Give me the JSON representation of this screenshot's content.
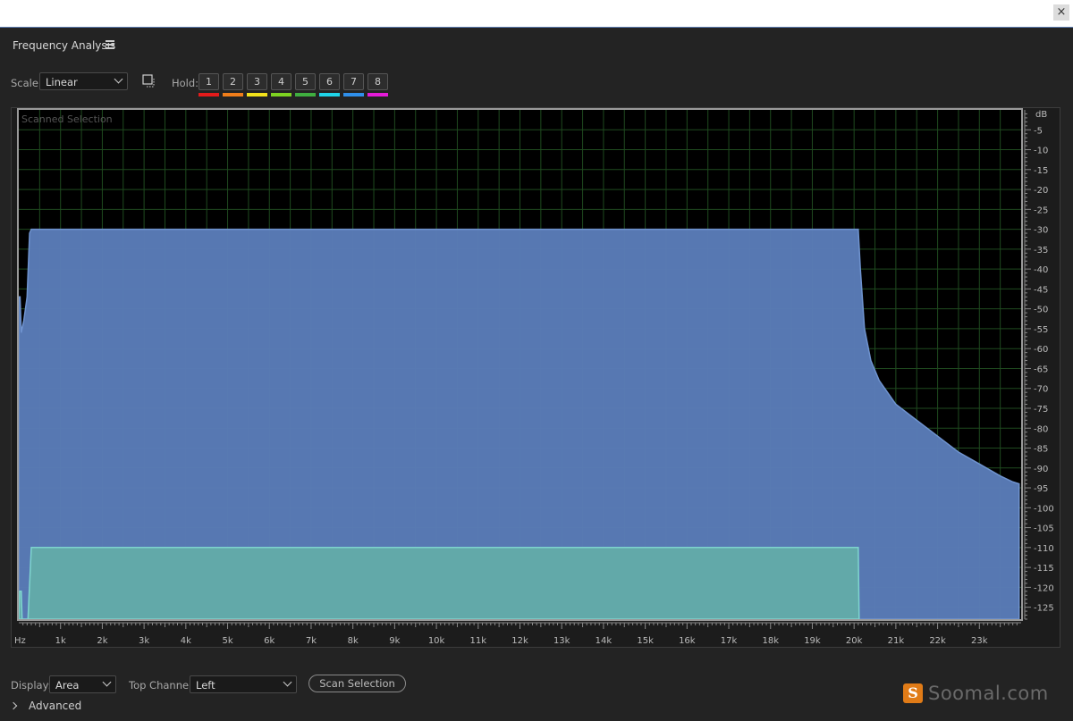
{
  "window": {
    "close_label": "×"
  },
  "panel": {
    "title": "Frequency Analysis"
  },
  "toolbar": {
    "scale_label": "Scale:",
    "scale_value": "Linear",
    "hold_label": "Hold:",
    "hold_buttons": [
      {
        "label": "1",
        "color": "#e41b1b"
      },
      {
        "label": "2",
        "color": "#f07d1a"
      },
      {
        "label": "3",
        "color": "#f2e21b"
      },
      {
        "label": "4",
        "color": "#7ed321"
      },
      {
        "label": "5",
        "color": "#3fae3f"
      },
      {
        "label": "6",
        "color": "#1fd4e8"
      },
      {
        "label": "7",
        "color": "#2f8fea"
      },
      {
        "label": "8",
        "color": "#e41bd8"
      }
    ]
  },
  "bottom": {
    "display_label": "Display:",
    "display_value": "Area",
    "channel_label": "Top Channel:",
    "channel_value": "Left",
    "scan_button": "Scan Selection",
    "advanced_label": "Advanced"
  },
  "watermark": {
    "logo": "S",
    "text": "Soomal.com"
  },
  "chart_data": {
    "type": "area",
    "title": "Scanned Selection",
    "x_unit": "Hz",
    "y_unit": "dB",
    "xlim": [
      0,
      24000
    ],
    "ylim": [
      -128,
      0
    ],
    "x_ticks": [
      {
        "v": 1000,
        "label": "1k"
      },
      {
        "v": 2000,
        "label": "2k"
      },
      {
        "v": 3000,
        "label": "3k"
      },
      {
        "v": 4000,
        "label": "4k"
      },
      {
        "v": 5000,
        "label": "5k"
      },
      {
        "v": 6000,
        "label": "6k"
      },
      {
        "v": 7000,
        "label": "7k"
      },
      {
        "v": 8000,
        "label": "8k"
      },
      {
        "v": 9000,
        "label": "9k"
      },
      {
        "v": 10000,
        "label": "10k"
      },
      {
        "v": 11000,
        "label": "11k"
      },
      {
        "v": 12000,
        "label": "12k"
      },
      {
        "v": 13000,
        "label": "13k"
      },
      {
        "v": 14000,
        "label": "14k"
      },
      {
        "v": 15000,
        "label": "15k"
      },
      {
        "v": 16000,
        "label": "16k"
      },
      {
        "v": 17000,
        "label": "17k"
      },
      {
        "v": 18000,
        "label": "18k"
      },
      {
        "v": 19000,
        "label": "19k"
      },
      {
        "v": 20000,
        "label": "20k"
      },
      {
        "v": 21000,
        "label": "21k"
      },
      {
        "v": 22000,
        "label": "22k"
      },
      {
        "v": 23000,
        "label": "23k"
      }
    ],
    "y_ticks": [
      -5,
      -10,
      -15,
      -20,
      -25,
      -30,
      -35,
      -40,
      -45,
      -50,
      -55,
      -60,
      -65,
      -70,
      -75,
      -80,
      -85,
      -90,
      -95,
      -100,
      -105,
      -110,
      -115,
      -120,
      -125
    ],
    "grid": true,
    "series": [
      {
        "fill": "#5a7cb8",
        "stroke": "#6f93cf",
        "points": [
          [
            0,
            -128
          ],
          [
            0,
            -47
          ],
          [
            30,
            -47
          ],
          [
            60,
            -56
          ],
          [
            120,
            -53
          ],
          [
            200,
            -47
          ],
          [
            260,
            -31
          ],
          [
            300,
            -30
          ],
          [
            20100,
            -30
          ],
          [
            20150,
            -40
          ],
          [
            20250,
            -55
          ],
          [
            20400,
            -63
          ],
          [
            20600,
            -68
          ],
          [
            21000,
            -74
          ],
          [
            21500,
            -78
          ],
          [
            22000,
            -82
          ],
          [
            22500,
            -86
          ],
          [
            23000,
            -89
          ],
          [
            23500,
            -92
          ],
          [
            23800,
            -93.5
          ],
          [
            23950,
            -94
          ],
          [
            23950,
            -128
          ]
        ]
      },
      {
        "fill": "#62aaa8",
        "stroke": "#7fd4cf",
        "points": [
          [
            0,
            -128
          ],
          [
            20,
            -121
          ],
          [
            60,
            -121
          ],
          [
            80,
            -128
          ],
          [
            220,
            -128
          ],
          [
            300,
            -110
          ],
          [
            20100,
            -110
          ],
          [
            20120,
            -128
          ]
        ]
      }
    ]
  }
}
